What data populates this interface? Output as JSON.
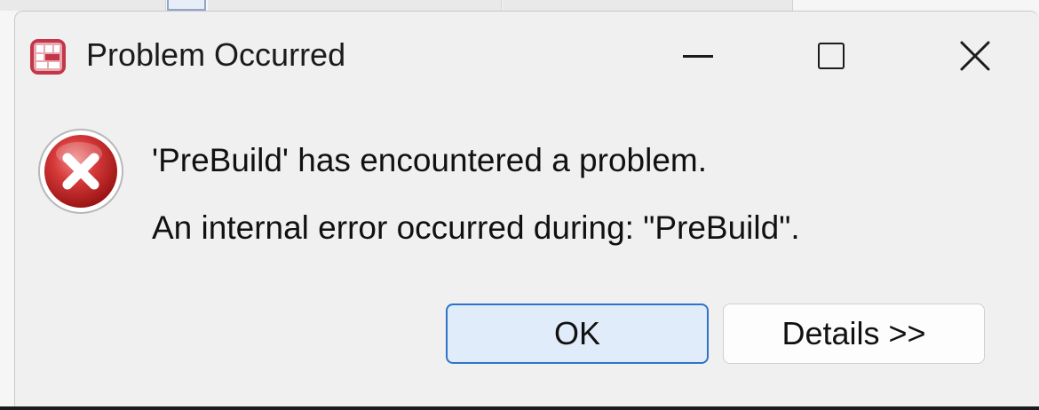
{
  "window": {
    "title": "Problem Occurred",
    "app_icon": "eclipse-app-icon"
  },
  "window_controls": {
    "minimize_icon": "minimize-icon",
    "maximize_icon": "maximize-icon",
    "close_icon": "close-icon"
  },
  "message": {
    "icon": "error-icon",
    "line1": "'PreBuild' has encountered a problem.",
    "line2": "An internal error occurred during: \"PreBuild\"."
  },
  "buttons": {
    "ok_label": "OK",
    "details_label": "Details >>"
  },
  "colors": {
    "dialog_background": "#f0f0f0",
    "default_button_border": "#2f73c9",
    "default_button_fill": "#e0ecf9",
    "error_red": "#d03030"
  }
}
